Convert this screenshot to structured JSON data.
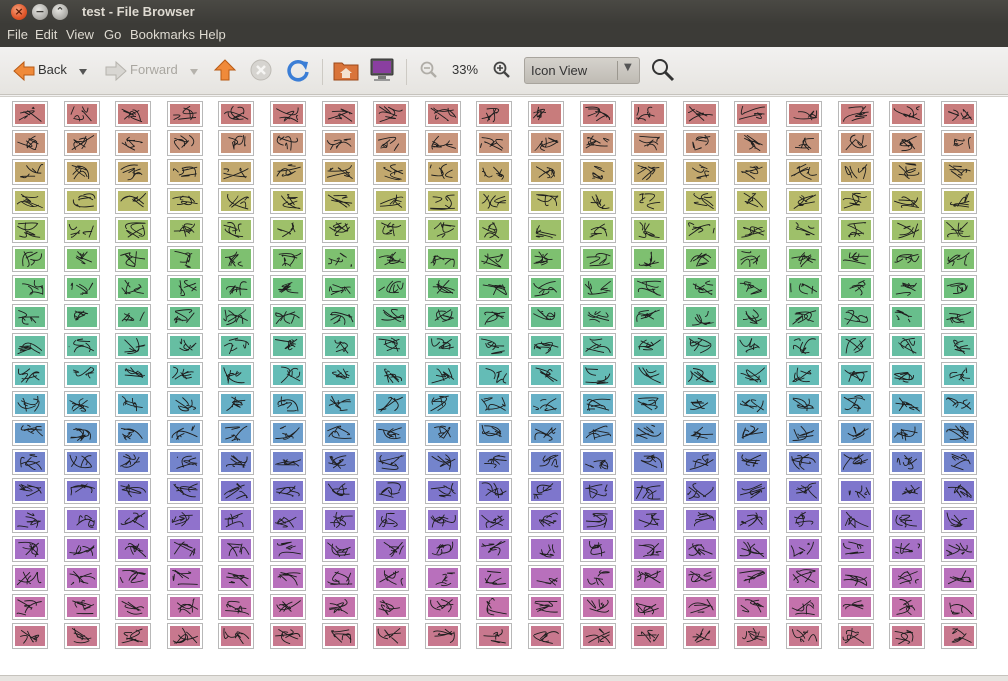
{
  "window": {
    "title": "test - File Browser"
  },
  "controls": {
    "close": "×",
    "minimize": "−",
    "maximize": "⌃"
  },
  "menubar": {
    "items": [
      "File",
      "Edit",
      "View",
      "Go",
      "Bookmarks",
      "Help"
    ]
  },
  "toolbar": {
    "back_label": "Back",
    "forward_label": "Forward",
    "zoom_level": "33%",
    "view_mode": "Icon View",
    "icons": [
      "back-arrow-icon",
      "back-dropdown-icon",
      "forward-arrow-icon",
      "forward-dropdown-icon",
      "up-arrow-icon",
      "stop-icon",
      "reload-icon",
      "home-folder-icon",
      "computer-icon",
      "zoom-out-icon",
      "zoom-in-icon",
      "search-icon"
    ]
  },
  "grid": {
    "columns": 19,
    "rows": 19,
    "row_colors": [
      "#c87c7c",
      "#c8957c",
      "#c2a86e",
      "#b8ba6a",
      "#9ec06a",
      "#7ec070",
      "#6ec07c",
      "#68be8c",
      "#66bea2",
      "#64bcb6",
      "#66b0c6",
      "#6c9ecc",
      "#7484cc",
      "#7e76cc",
      "#9072cc",
      "#a670c6",
      "#b870bc",
      "#c472ac",
      "#c8788e"
    ]
  }
}
